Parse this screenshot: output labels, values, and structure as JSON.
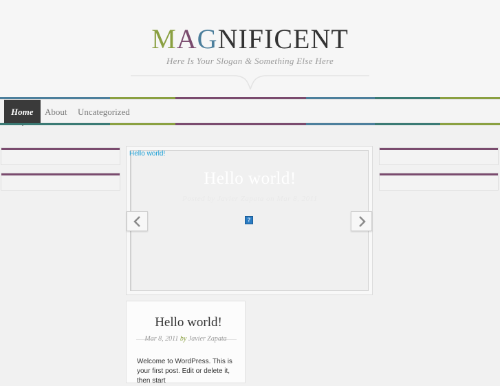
{
  "site": {
    "title_parts": [
      "M",
      "A",
      "G",
      "NIFICENT"
    ],
    "slogan": "Here Is Your Slogan & Something Else Here"
  },
  "nav": {
    "items": [
      {
        "label": "Home",
        "active": true
      },
      {
        "label": "About",
        "active": false
      },
      {
        "label": "Uncategorized",
        "active": false
      }
    ]
  },
  "featured": {
    "link_text": "Hello world!",
    "title": "Hello world!",
    "meta": "Posted by Javier Zapata on Mar 8, 2011",
    "broken_image_glyph": "?",
    "prev_icon": "chevron-left-icon",
    "next_icon": "chevron-right-icon"
  },
  "post": {
    "title": "Hello world!",
    "date": "Mar 8, 2011",
    "by": "by",
    "author": "Javier Zapata",
    "excerpt": "Welcome to WordPress. This is your first post. Edit or delete it, then start"
  },
  "colors": {
    "accent_green": "#8aa041",
    "accent_purple": "#7a4b6e",
    "accent_blue": "#4c7f9c",
    "link_blue": "#1ea0d6",
    "nav_active_bg": "#3a3a3a"
  }
}
